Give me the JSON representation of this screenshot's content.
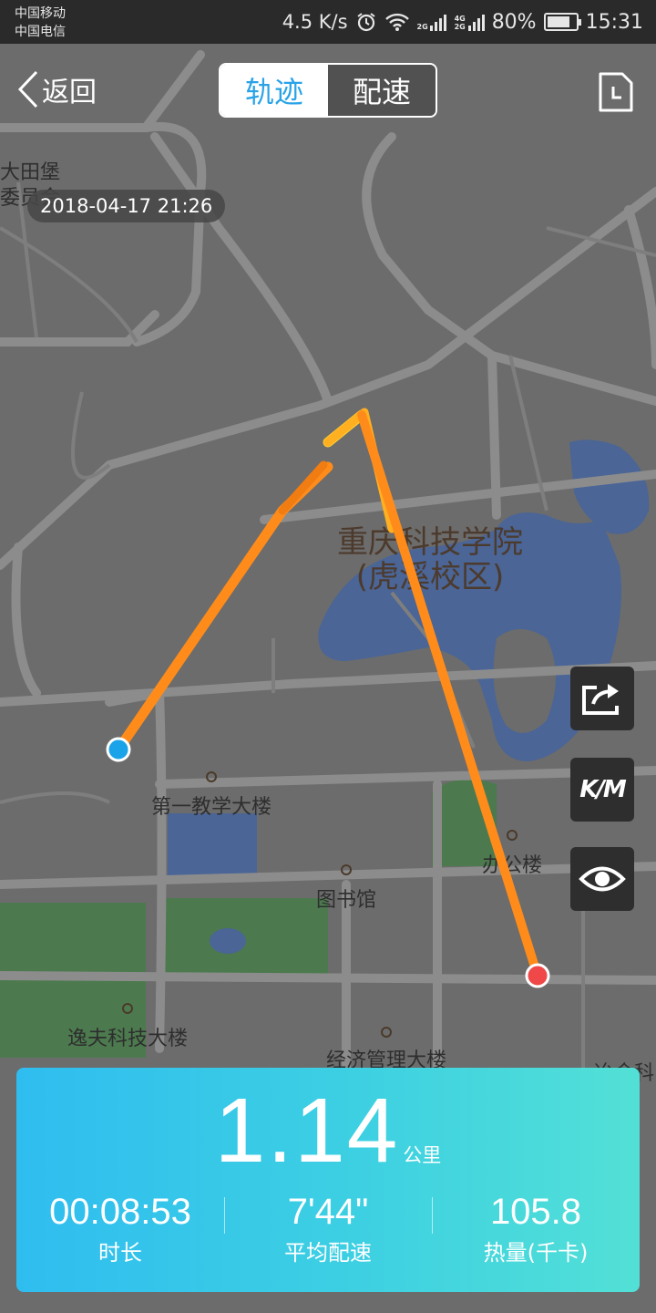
{
  "status_bar": {
    "carrier_1": "中国移动",
    "carrier_2": "中国电信",
    "speed": "4.5 K/s",
    "alarm_icon": "alarm-clock-icon",
    "wifi_icon": "wifi-icon",
    "signal_1_label": "2G",
    "signal_2_label": "4G 2G",
    "battery_percent": "80%",
    "battery_level": 0.8,
    "time": "15:31"
  },
  "nav": {
    "back_label": "返回",
    "tabs": [
      {
        "label": "轨迹",
        "active": true
      },
      {
        "label": "配速",
        "active": false
      }
    ],
    "record_icon": "document-clock-icon"
  },
  "run_timestamp": "2018-04-17 21:26",
  "map_labels": {
    "campus_name_1": "重庆科技学院",
    "campus_name_2": "(虎溪校区)",
    "top_left_1": "大田堡",
    "top_left_2": "委员会",
    "building_1": "第一教学大楼",
    "building_2": "办公楼",
    "building_3": "图书馆",
    "building_4": "逸夫科技大楼",
    "building_5": "经济管理大楼",
    "edge_label": "冶金科"
  },
  "side_buttons": [
    {
      "name": "share",
      "icon": "share-icon"
    },
    {
      "name": "km-markers",
      "label": "K/M"
    },
    {
      "name": "visibility",
      "icon": "eye-icon"
    }
  ],
  "summary": {
    "distance": "1.14",
    "distance_unit": "公里",
    "stats": [
      {
        "value": "00:08:53",
        "label": "时长"
      },
      {
        "value": "7'44\"",
        "label": "平均配速"
      },
      {
        "value": "105.8",
        "label": "热量(千卡)"
      }
    ]
  },
  "colors": {
    "accent": "#29a3e6",
    "route": "#ff8c1a",
    "start_marker": "#1aa3e8",
    "end_marker": "#f04848",
    "water": "#4a6596",
    "green_area": "#4c7a4e"
  }
}
